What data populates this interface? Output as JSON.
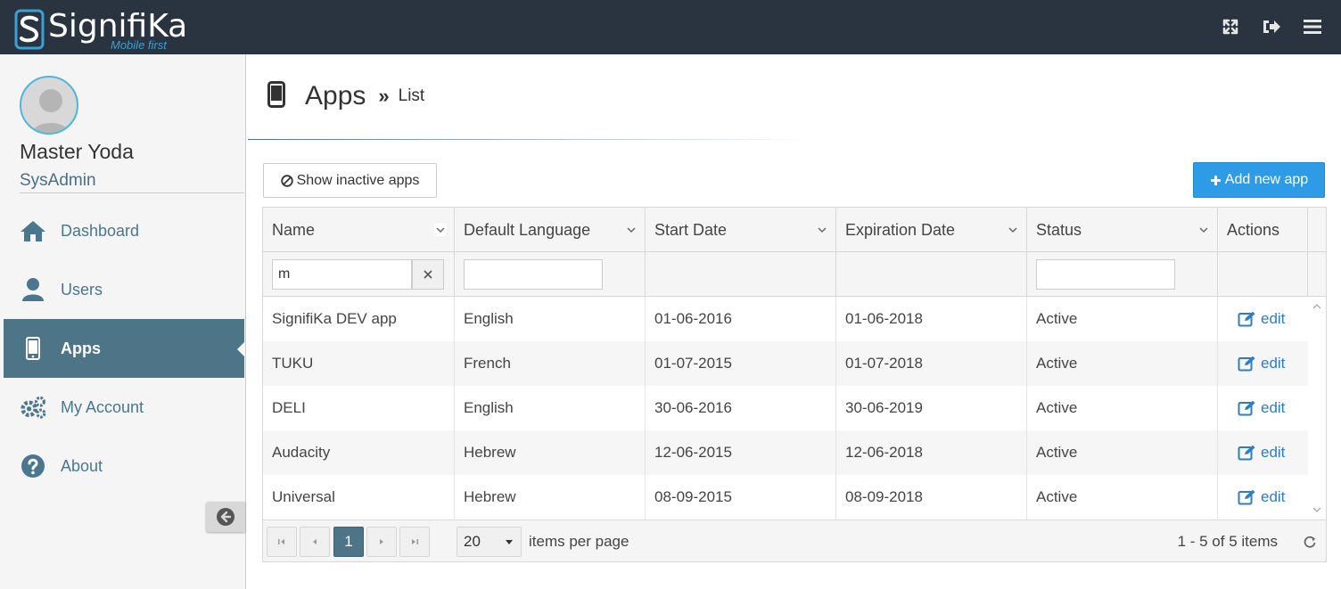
{
  "header": {
    "logo_text": "SignifiKa",
    "logo_sub": "Mobile first",
    "icons": [
      "fullscreen-icon",
      "logout-icon",
      "hamburger-menu-icon"
    ]
  },
  "user": {
    "name": "Master Yoda",
    "role": "SysAdmin"
  },
  "sidebar": {
    "items": [
      {
        "label": "Dashboard",
        "icon": "home-icon",
        "active": false
      },
      {
        "label": "Users",
        "icon": "user-icon",
        "active": false
      },
      {
        "label": "Apps",
        "icon": "mobile-icon",
        "active": true
      },
      {
        "label": "My Account",
        "icon": "gears-icon",
        "active": false
      },
      {
        "label": "About",
        "icon": "question-circle-icon",
        "active": false
      }
    ]
  },
  "page": {
    "title": "Apps",
    "separator": "»",
    "subtitle": "List"
  },
  "toolbar": {
    "show_inactive_label": "Show inactive apps",
    "add_label": "Add new app"
  },
  "grid": {
    "columns": [
      "Name",
      "Default Language",
      "Start Date",
      "Expiration Date",
      "Status",
      "Actions"
    ],
    "filters": {
      "name": "m",
      "default_language": "",
      "status": ""
    },
    "rows": [
      {
        "name": "SignifiKa DEV app",
        "language": "English",
        "start": "01-06-2016",
        "expiration": "01-06-2018",
        "status": "Active",
        "action": "edit"
      },
      {
        "name": "TUKU",
        "language": "French",
        "start": "01-07-2015",
        "expiration": "01-07-2018",
        "status": "Active",
        "action": "edit"
      },
      {
        "name": "DELI",
        "language": "English",
        "start": "30-06-2016",
        "expiration": "30-06-2019",
        "status": "Active",
        "action": "edit"
      },
      {
        "name": "Audacity",
        "language": "Hebrew",
        "start": "12-06-2015",
        "expiration": "12-06-2018",
        "status": "Active",
        "action": "edit"
      },
      {
        "name": "Universal",
        "language": "Hebrew",
        "start": "08-09-2015",
        "expiration": "08-09-2018",
        "status": "Active",
        "action": "edit"
      }
    ]
  },
  "pager": {
    "current_page": "1",
    "page_size": "20",
    "page_size_label": "items per page",
    "info": "1 - 5 of 5 items"
  },
  "colors": {
    "topbar": "#2a3440",
    "active_nav": "#4e7487",
    "primary": "#2e9be6",
    "link": "#2e7dc2"
  }
}
